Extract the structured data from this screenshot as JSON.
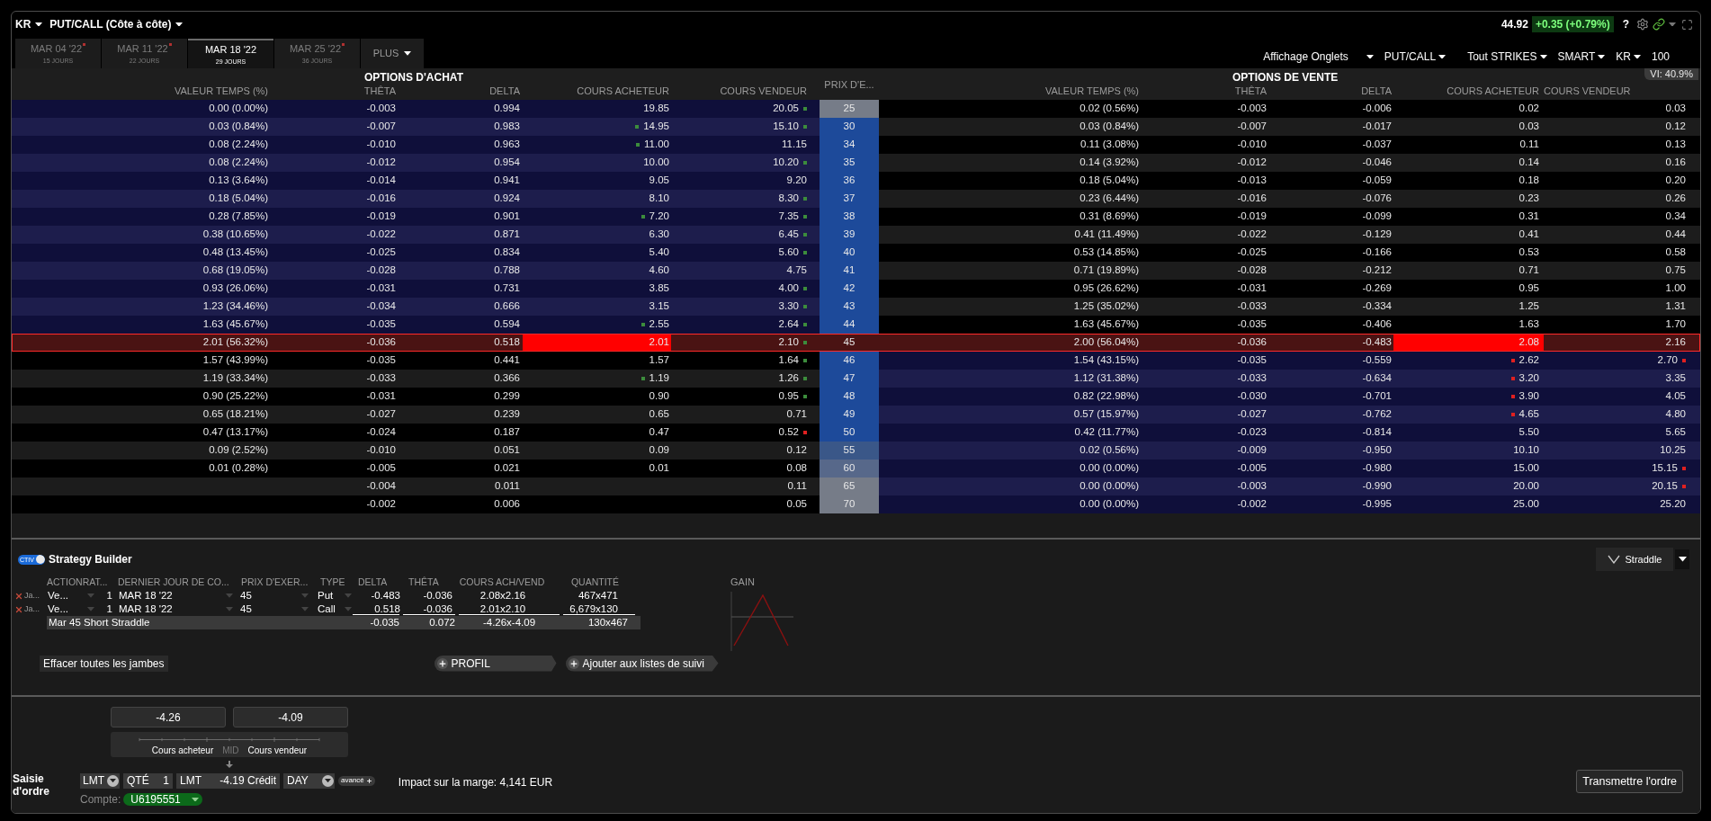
{
  "top_bar": {
    "symbol": "KR",
    "view": "PUT/CALL (Côte à côte)",
    "last_price": "44.92",
    "change": "+0.35 (+0.79%)",
    "help": "?"
  },
  "expiry_tabs": [
    {
      "date": "MAR 04 '22",
      "days": "15 JOURS",
      "selected": false,
      "flagged": true
    },
    {
      "date": "MAR 11 '22",
      "days": "22 JOURS",
      "selected": false,
      "flagged": true
    },
    {
      "date": "MAR 18 '22",
      "days": "29 JOURS",
      "selected": true,
      "flagged": false
    },
    {
      "date": "MAR 25 '22",
      "days": "36 JOURS",
      "selected": false,
      "flagged": true
    }
  ],
  "more_tab": "PLUS",
  "toolbar": [
    {
      "label": "Affichage Onglets",
      "dropdown": true
    },
    {
      "label": "PUT/CALL",
      "dropdown": true
    },
    {
      "label": "Tout STRIKES",
      "dropdown": true
    },
    {
      "label": "SMART",
      "dropdown": true
    },
    {
      "label": "KR",
      "dropdown": true
    },
    {
      "label": "100",
      "dropdown": false
    }
  ],
  "vi": "VI: 40.9%",
  "chain": {
    "call_title": "OPTIONS D'ACHAT",
    "put_title": "OPTIONS DE VENTE",
    "call_columns": [
      "VALEUR TEMPS (%)",
      "THÊTA",
      "DELTA",
      "COURS ACHETEUR",
      "COURS VENDEUR"
    ],
    "strike_column": "PRIX D'E...",
    "put_columns": [
      "VALEUR TEMPS (%)",
      "THÊTA",
      "DELTA",
      "COURS ACHETEUR",
      "COURS VENDEUR"
    ],
    "rows": [
      {
        "strike": {
          "value": "25",
          "color": "#767c88"
        },
        "call_itm": true,
        "put_itm": false,
        "selected": false,
        "call": {
          "time_value": "0.00 (0.00%)",
          "theta": "-0.003",
          "delta": "0.994",
          "bid": "19.85",
          "ask": "20.05",
          "ask_tick": {
            "color": "#3c8c3c"
          }
        },
        "put": {
          "time_value": "0.02 (0.56%)",
          "theta": "-0.003",
          "delta": "-0.006",
          "bid": "0.02",
          "ask": "0.03"
        }
      },
      {
        "strike": {
          "value": "30",
          "color": "#1d4a9a"
        },
        "call_itm": true,
        "put_itm": false,
        "selected": false,
        "call": {
          "time_value": "0.03 (0.84%)",
          "theta": "-0.007",
          "delta": "0.983",
          "bid": "14.95",
          "ask": "15.10",
          "bid_tick": {
            "color": "#3c8c3c"
          },
          "ask_tick": {
            "color": "#3c8c3c"
          }
        },
        "put": {
          "time_value": "0.03 (0.84%)",
          "theta": "-0.007",
          "delta": "-0.017",
          "bid": "0.03",
          "ask": "0.12"
        }
      },
      {
        "strike": {
          "value": "34",
          "color": "#1d4a9a"
        },
        "call_itm": true,
        "put_itm": false,
        "selected": false,
        "call": {
          "time_value": "0.08 (2.24%)",
          "theta": "-0.010",
          "delta": "0.963",
          "bid": "11.00",
          "ask": "11.15",
          "bid_tick": {
            "color": "#3c8c3c"
          }
        },
        "put": {
          "time_value": "0.11 (3.08%)",
          "theta": "-0.010",
          "delta": "-0.037",
          "bid": "0.11",
          "ask": "0.13"
        }
      },
      {
        "strike": {
          "value": "35",
          "color": "#1d4a9a"
        },
        "call_itm": true,
        "put_itm": false,
        "selected": false,
        "call": {
          "time_value": "0.08 (2.24%)",
          "theta": "-0.012",
          "delta": "0.954",
          "bid": "10.00",
          "ask": "10.20",
          "ask_tick": {
            "color": "#3c8c3c"
          }
        },
        "put": {
          "time_value": "0.14 (3.92%)",
          "theta": "-0.012",
          "delta": "-0.046",
          "bid": "0.14",
          "ask": "0.16"
        }
      },
      {
        "strike": {
          "value": "36",
          "color": "#1d4a9a"
        },
        "call_itm": true,
        "put_itm": false,
        "selected": false,
        "call": {
          "time_value": "0.13 (3.64%)",
          "theta": "-0.014",
          "delta": "0.941",
          "bid": "9.05",
          "ask": "9.20"
        },
        "put": {
          "time_value": "0.18 (5.04%)",
          "theta": "-0.013",
          "delta": "-0.059",
          "bid": "0.18",
          "ask": "0.20"
        }
      },
      {
        "strike": {
          "value": "37",
          "color": "#1d4a9a"
        },
        "call_itm": true,
        "put_itm": false,
        "selected": false,
        "call": {
          "time_value": "0.18 (5.04%)",
          "theta": "-0.016",
          "delta": "0.924",
          "bid": "8.10",
          "ask": "8.30",
          "ask_tick": {
            "color": "#3c8c3c"
          }
        },
        "put": {
          "time_value": "0.23 (6.44%)",
          "theta": "-0.016",
          "delta": "-0.076",
          "bid": "0.23",
          "ask": "0.26"
        }
      },
      {
        "strike": {
          "value": "38",
          "color": "#1d4a9a"
        },
        "call_itm": true,
        "put_itm": false,
        "selected": false,
        "call": {
          "time_value": "0.28 (7.85%)",
          "theta": "-0.019",
          "delta": "0.901",
          "bid": "7.20",
          "ask": "7.35",
          "bid_tick": {
            "color": "#3c8c3c"
          },
          "ask_tick": {
            "color": "#3c8c3c"
          }
        },
        "put": {
          "time_value": "0.31 (8.69%)",
          "theta": "-0.019",
          "delta": "-0.099",
          "bid": "0.31",
          "ask": "0.34"
        }
      },
      {
        "strike": {
          "value": "39",
          "color": "#1d4a9a"
        },
        "call_itm": true,
        "put_itm": false,
        "selected": false,
        "call": {
          "time_value": "0.38 (10.65%)",
          "theta": "-0.022",
          "delta": "0.871",
          "bid": "6.30",
          "ask": "6.45",
          "ask_tick": {
            "color": "#3c8c3c"
          }
        },
        "put": {
          "time_value": "0.41 (11.49%)",
          "theta": "-0.022",
          "delta": "-0.129",
          "bid": "0.41",
          "ask": "0.44"
        }
      },
      {
        "strike": {
          "value": "40",
          "color": "#1d4a9a"
        },
        "call_itm": true,
        "put_itm": false,
        "selected": false,
        "call": {
          "time_value": "0.48 (13.45%)",
          "theta": "-0.025",
          "delta": "0.834",
          "bid": "5.40",
          "ask": "5.60",
          "ask_tick": {
            "color": "#3c8c3c"
          }
        },
        "put": {
          "time_value": "0.53 (14.85%)",
          "theta": "-0.025",
          "delta": "-0.166",
          "bid": "0.53",
          "ask": "0.58"
        }
      },
      {
        "strike": {
          "value": "41",
          "color": "#1d4a9a"
        },
        "call_itm": true,
        "put_itm": false,
        "selected": false,
        "call": {
          "time_value": "0.68 (19.05%)",
          "theta": "-0.028",
          "delta": "0.788",
          "bid": "4.60",
          "ask": "4.75"
        },
        "put": {
          "time_value": "0.71 (19.89%)",
          "theta": "-0.028",
          "delta": "-0.212",
          "bid": "0.71",
          "ask": "0.75"
        }
      },
      {
        "strike": {
          "value": "42",
          "color": "#1d4a9a"
        },
        "call_itm": true,
        "put_itm": false,
        "selected": false,
        "call": {
          "time_value": "0.93 (26.06%)",
          "theta": "-0.031",
          "delta": "0.731",
          "bid": "3.85",
          "ask": "4.00",
          "ask_tick": {
            "color": "#3c8c3c"
          }
        },
        "put": {
          "time_value": "0.95 (26.62%)",
          "theta": "-0.031",
          "delta": "-0.269",
          "bid": "0.95",
          "ask": "1.00"
        }
      },
      {
        "strike": {
          "value": "43",
          "color": "#1d4a9a"
        },
        "call_itm": true,
        "put_itm": false,
        "selected": false,
        "call": {
          "time_value": "1.23 (34.46%)",
          "theta": "-0.034",
          "delta": "0.666",
          "bid": "3.15",
          "ask": "3.30",
          "ask_tick": {
            "color": "#3c8c3c"
          }
        },
        "put": {
          "time_value": "1.25 (35.02%)",
          "theta": "-0.033",
          "delta": "-0.334",
          "bid": "1.25",
          "ask": "1.31"
        }
      },
      {
        "strike": {
          "value": "44",
          "color": "#1d4a9a"
        },
        "call_itm": true,
        "put_itm": false,
        "selected": false,
        "call": {
          "time_value": "1.63 (45.67%)",
          "theta": "-0.035",
          "delta": "0.594",
          "bid": "2.55",
          "ask": "2.64",
          "bid_tick": {
            "color": "#3c8c3c"
          },
          "ask_tick": {
            "color": "#3c8c3c"
          }
        },
        "put": {
          "time_value": "1.63 (45.67%)",
          "theta": "-0.035",
          "delta": "-0.406",
          "bid": "1.63",
          "ask": "1.70"
        }
      },
      {
        "strike": {
          "value": "45"
        },
        "selected": true,
        "call": {
          "time_value": "2.01 (56.32%)",
          "theta": "-0.036",
          "delta": "0.518",
          "bid": "2.01",
          "ask": "2.10",
          "ask_tick": {
            "color": "#3c8c3c"
          }
        },
        "put": {
          "time_value": "2.00 (56.04%)",
          "theta": "-0.036",
          "delta": "-0.483",
          "bid": "2.08",
          "ask": "2.16"
        }
      },
      {
        "strike": {
          "value": "46",
          "color": "#1d4a9a"
        },
        "call_itm": false,
        "put_itm": true,
        "selected": false,
        "call": {
          "time_value": "1.57 (43.99%)",
          "theta": "-0.035",
          "delta": "0.441",
          "bid": "1.57",
          "ask": "1.64",
          "ask_tick": {
            "color": "#3c8c3c"
          }
        },
        "put": {
          "time_value": "1.54 (43.15%)",
          "theta": "-0.035",
          "delta": "-0.559",
          "bid": "2.62",
          "ask": "2.70",
          "bid_tick": {
            "color": "#e02020"
          },
          "ask_tick": {
            "color": "#e02020"
          }
        }
      },
      {
        "strike": {
          "value": "47",
          "color": "#1d4a9a"
        },
        "call_itm": false,
        "put_itm": true,
        "selected": false,
        "call": {
          "time_value": "1.19 (33.34%)",
          "theta": "-0.033",
          "delta": "0.366",
          "bid": "1.19",
          "ask": "1.26",
          "bid_tick": {
            "color": "#3c8c3c"
          },
          "ask_tick": {
            "color": "#3c8c3c"
          }
        },
        "put": {
          "time_value": "1.12 (31.38%)",
          "theta": "-0.033",
          "delta": "-0.634",
          "bid": "3.20",
          "ask": "3.35",
          "bid_tick": {
            "color": "#e02020"
          }
        }
      },
      {
        "strike": {
          "value": "48",
          "color": "#1d4a9a"
        },
        "call_itm": false,
        "put_itm": true,
        "selected": false,
        "call": {
          "time_value": "0.90 (25.22%)",
          "theta": "-0.031",
          "delta": "0.299",
          "bid": "0.90",
          "ask": "0.95",
          "ask_tick": {
            "color": "#3c8c3c"
          }
        },
        "put": {
          "time_value": "0.82 (22.98%)",
          "theta": "-0.030",
          "delta": "-0.701",
          "bid": "3.90",
          "ask": "4.05",
          "bid_tick": {
            "color": "#e02020"
          }
        }
      },
      {
        "strike": {
          "value": "49",
          "color": "#1d4a9a"
        },
        "call_itm": false,
        "put_itm": true,
        "selected": false,
        "call": {
          "time_value": "0.65 (18.21%)",
          "theta": "-0.027",
          "delta": "0.239",
          "bid": "0.65",
          "ask": "0.71"
        },
        "put": {
          "time_value": "0.57 (15.97%)",
          "theta": "-0.027",
          "delta": "-0.762",
          "bid": "4.65",
          "ask": "4.80",
          "bid_tick": {
            "color": "#e02020"
          }
        }
      },
      {
        "strike": {
          "value": "50",
          "color": "#1d4a9a"
        },
        "call_itm": false,
        "put_itm": true,
        "selected": false,
        "call": {
          "time_value": "0.47 (13.17%)",
          "theta": "-0.024",
          "delta": "0.187",
          "bid": "0.47",
          "ask": "0.52",
          "ask_tick": {
            "color": "#e02020"
          }
        },
        "put": {
          "time_value": "0.42 (11.77%)",
          "theta": "-0.023",
          "delta": "-0.814",
          "bid": "5.50",
          "ask": "5.65"
        }
      },
      {
        "strike": {
          "value": "55",
          "color": "#3a5788"
        },
        "call_itm": false,
        "put_itm": true,
        "selected": false,
        "call": {
          "time_value": "0.09 (2.52%)",
          "theta": "-0.010",
          "delta": "0.051",
          "bid": "0.09",
          "ask": "0.12"
        },
        "put": {
          "time_value": "0.02 (0.56%)",
          "theta": "-0.009",
          "delta": "-0.950",
          "bid": "10.10",
          "ask": "10.25"
        }
      },
      {
        "strike": {
          "value": "60",
          "color": "#57688a"
        },
        "call_itm": false,
        "put_itm": true,
        "selected": false,
        "call": {
          "time_value": "0.01 (0.28%)",
          "theta": "-0.005",
          "delta": "0.021",
          "bid": "0.01",
          "ask": "0.08"
        },
        "put": {
          "time_value": "0.00 (0.00%)",
          "theta": "-0.005",
          "delta": "-0.980",
          "bid": "15.00",
          "ask": "15.15",
          "ask_tick": {
            "color": "#e02020"
          }
        }
      },
      {
        "strike": {
          "value": "65",
          "color": "#767c88"
        },
        "call_itm": false,
        "put_itm": true,
        "selected": false,
        "call": {
          "theta": "-0.004",
          "delta": "0.011",
          "ask": "0.11"
        },
        "put": {
          "time_value": "0.00 (0.00%)",
          "theta": "-0.003",
          "delta": "-0.990",
          "bid": "20.00",
          "ask": "20.15",
          "ask_tick": {
            "color": "#e02020"
          }
        }
      },
      {
        "strike": {
          "value": "70",
          "color": "#767c88"
        },
        "call_itm": false,
        "put_itm": true,
        "selected": false,
        "call": {
          "theta": "-0.002",
          "delta": "0.006",
          "ask": "0.05"
        },
        "put": {
          "time_value": "0.00 (0.00%)",
          "theta": "-0.002",
          "delta": "-0.995",
          "bid": "25.00",
          "ask": "25.20"
        }
      }
    ]
  },
  "strategy_builder": {
    "toggle": {
      "label": "CTIV",
      "on": true
    },
    "title": "Strategy Builder",
    "strategy_button": "Straddle",
    "columns": [
      "ACTIONRAT...",
      "DERNIER JOUR DE CO...",
      "PRIX D'EXER...",
      "TYPE",
      "DELTA",
      "THÊTA",
      "COURS ACH/VEND",
      "QUANTITÉ"
    ],
    "legs": [
      {
        "leg": "Ja...",
        "action": "Ve...",
        "ratio": "1",
        "expiry": "MAR 18 '22",
        "strike": "45",
        "type": "Put",
        "delta": "-0.483",
        "theta": "-0.036",
        "bid_ask": "2.08x2.16",
        "quantity": "467x471"
      },
      {
        "leg": "Ja...",
        "action": "Ve...",
        "ratio": "1",
        "expiry": "MAR 18 '22",
        "strike": "45",
        "type": "Call",
        "delta": "0.518",
        "theta": "-0.036",
        "bid_ask": "2.01x2.10",
        "quantity": "6,679x130"
      }
    ],
    "total": {
      "label": "Mar 45 Short Straddle",
      "delta": "-0.035",
      "theta": "0.072",
      "bid_ask": "-4.26x-4.09",
      "quantity": "130x467"
    },
    "chart_label": "GAIN",
    "clear_button": "Effacer toutes les jambes",
    "profile_button": "PROFIL",
    "watchlist_button": "Ajouter aux listes de suivi"
  },
  "order": {
    "bid_price": "-4.26",
    "ask_price": "-4.09",
    "scale_labels": [
      "Cours acheteur",
      "MID",
      "Cours vendeur"
    ],
    "title": "Saisie d'ordre",
    "order_type": "LMT",
    "qty_label": "QTÉ",
    "qty": "1",
    "price_type": "LMT",
    "price": "-4.19 Crédit",
    "tif": "DAY",
    "advanced": "avancé",
    "account_label": "Compte:",
    "account": "U6195551",
    "margin_impact": "Impact sur la marge: 4,141 EUR",
    "submit": "Transmettre l'ordre"
  }
}
